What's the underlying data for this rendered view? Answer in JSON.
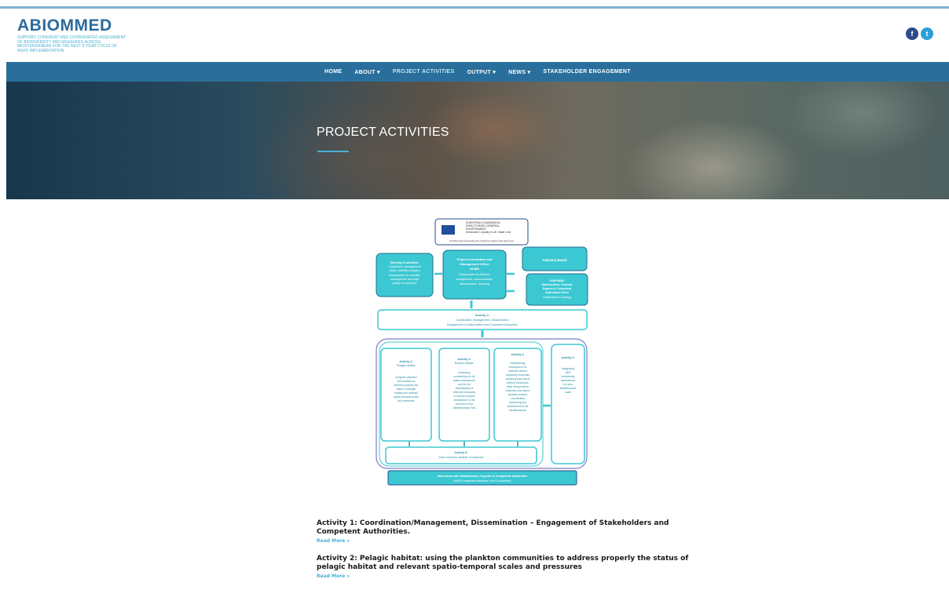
{
  "header": {
    "logo_title": "ABIOMMED",
    "logo_subtitle": "SUPPORT COHERENT AND COORDINATED ASSESSMENT OF BIODIVERSITY AND MEASURES ACROSS MEDITERRANEAN FOR THE NEXT 6-YEAR CYCLE OF MSFD IMPLEMENTATION",
    "social": [
      {
        "icon": "facebook-icon",
        "glyph": "f"
      },
      {
        "icon": "twitter-icon",
        "glyph": "t"
      }
    ]
  },
  "nav": {
    "items": [
      "HOME",
      "ABOUT ▾",
      "PROJECT ACTIVITIES",
      "OUTPUT ▾",
      "NEWS ▾",
      "STAKEHOLDER ENGAGEMENT"
    ],
    "active": "PROJECT ACTIVITIES"
  },
  "hero": {
    "title": "PROJECT ACTIVITIES"
  },
  "diagram": {
    "ec_box": [
      "EUROPEAN COMMISSION",
      "DIRECTORATE-GENERAL",
      "ENVIRONMENT",
      "Directorate C-Quality of Life, Water & Air"
    ],
    "ec_caption": "Funding and supervising the project's progress and outcomes",
    "steering": [
      "Steering Committee:",
      "Coordinator, Management",
      "Office, Activities Leaders",
      "Responsible for scientific",
      "management and high",
      "quality of outcomes"
    ],
    "coordinator": [
      "Project coordinator and",
      "Management Office",
      "HCMR",
      "Responsible for effective",
      "management, communication,",
      "dissemination, reporting"
    ],
    "advisory": "Advisory Board",
    "unep": [
      "UNEP/MAP",
      "Stakeholders, External",
      "Experts & Competent",
      "Authorities Panel",
      "Collaboration & Synergy"
    ],
    "activity1": [
      "Activity 1:",
      "Coordination, Management, Dissemination",
      "Engagement of Stakeholders and Competent Authorities"
    ],
    "activity2": [
      "Activity 2:",
      "Pelagic habitat:",
      "",
      "using the plankton",
      "communities to",
      "address properly the",
      "status of pelagic",
      "habitat and relevant",
      "spatio-temporal scales",
      "and pressures"
    ],
    "activity3": [
      "Activity 3:",
      "Benthic habitat:",
      "",
      "enhancing",
      "consistency for its",
      "status assessment",
      "and for the",
      "identification of",
      "effective measures",
      "to reduce physical",
      "disturbance to the",
      "sea floor in the",
      "Mediterranean Sea"
    ],
    "activity4": [
      "Activity 4:",
      "",
      "Streamlining",
      "Descriptor's D1",
      "selected criteria",
      "regarding mammals",
      "species groups (small",
      "toothed cetaceans,",
      "deep diving toothed",
      "cetaceans and baleen",
      "whales) towards",
      "coordinated",
      "monitoring and",
      "assessment in the",
      "Mediterranean"
    ],
    "activity6": [
      "Activity 6:",
      "",
      "Integrating",
      "GES",
      "biodiversity",
      "assessment",
      "in a pan-",
      "Mediterranean",
      "scale"
    ],
    "activity5": [
      "Activity 5:",
      "Socio-economic analysis of measures"
    ],
    "interaction": [
      "Interaction with Stakeholders, Experts & Competent Authorities",
      "(MSFD competent authorities, non EU countries)"
    ]
  },
  "activities": [
    {
      "title": "Activity 1: Coordination/Management, Dissemination – Engagement of Stakeholders and Competent Authorities.",
      "read_more": "Read More »"
    },
    {
      "title": "Activity 2: Pelagic habitat: using the plankton communities to address properly the status of pelagic habitat and relevant spatio-temporal scales and pressures",
      "read_more": "Read More »"
    }
  ],
  "colors": {
    "brand": "#2b6b9e",
    "accent": "#4ab0d6",
    "nav_bg": "#2a6f9c",
    "diagram_teal": "#3cc8d2",
    "diagram_border": "#1f6e8c"
  }
}
